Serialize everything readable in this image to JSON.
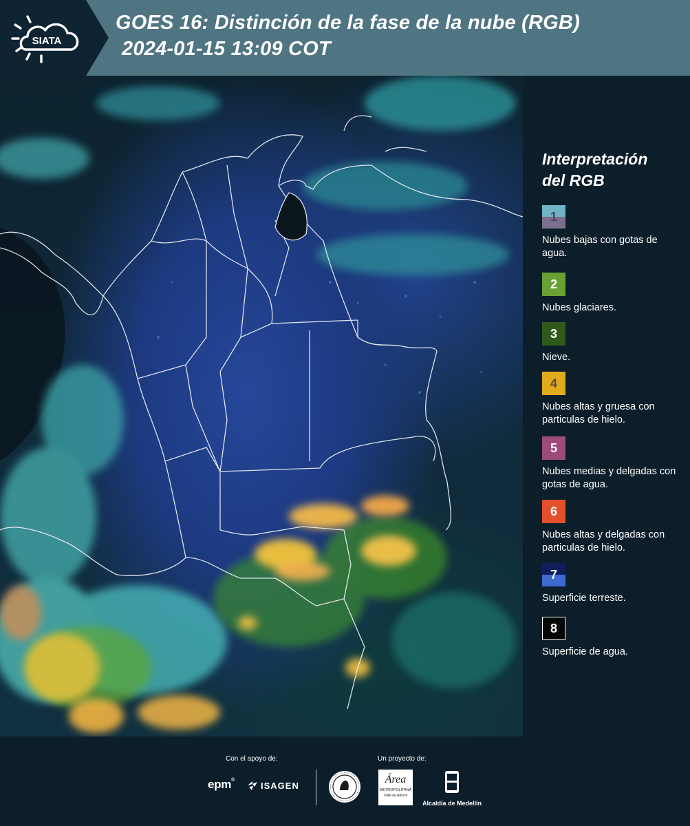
{
  "header": {
    "logo_text": "SIATA",
    "title_line1": "GOES 16: Distinción de la fase de la nube (RGB)",
    "title_line2": "2024-01-15 13:09 COT"
  },
  "legend": {
    "title_line1": "Interpretación",
    "title_line2": "del RGB",
    "items": [
      {
        "number": "1",
        "label": "Nubes bajas con gotas de agua.",
        "color_top": "#6fb3c4",
        "color_bottom": "#7c6f8c",
        "number_color": "#4a4a5a"
      },
      {
        "number": "2",
        "label": "Nubes glaciares.",
        "color_top": "#6aa135",
        "color_bottom": "#6aa135",
        "number_color": "#ffffff"
      },
      {
        "number": "3",
        "label": "Nieve.",
        "color_top": "#2f5a1c",
        "color_bottom": "#2f5a1c",
        "number_color": "#ffffff"
      },
      {
        "number": "4",
        "label": "Nubes altas y gruesa con particulas de hielo.",
        "color_top": "#e0aa1e",
        "color_bottom": "#e0aa1e",
        "number_color": "#5a4a2a"
      },
      {
        "number": "5",
        "label": "Nubes medias y delgadas con gotas de agua.",
        "color_top": "#9e4a7a",
        "color_bottom": "#9e4a7a",
        "number_color": "#ffffff"
      },
      {
        "number": "6",
        "label": "Nubes altas y delgadas con particulas de hielo.",
        "color_top": "#e4502c",
        "color_bottom": "#e4502c",
        "number_color": "#ffffff"
      },
      {
        "number": "7",
        "label": "Superficie terreste.",
        "color_top": "#101e5c",
        "color_bottom": "#3d6ad0",
        "number_color": "#ffffff"
      },
      {
        "number": "8",
        "label": "Superficie de agua.",
        "color_top": "#050806",
        "color_bottom": "#050806",
        "number_color": "#ffffff"
      }
    ]
  },
  "footer": {
    "support_label": "Con el apoyo de:",
    "project_label": "Un proyecto de:",
    "sponsor_epm": "epm",
    "sponsor_isagen": "ISAGEN",
    "area_logo_text": "Área",
    "area_logo_sub1": "METROPOLITANA",
    "area_logo_sub2": "Valle de Aburrá",
    "alcaldia_text": "Alcaldía de Medellín"
  },
  "colors": {
    "header_bg": "#4f7482",
    "logo_bg": "#0f2433",
    "page_bg": "#0c1e2a"
  }
}
